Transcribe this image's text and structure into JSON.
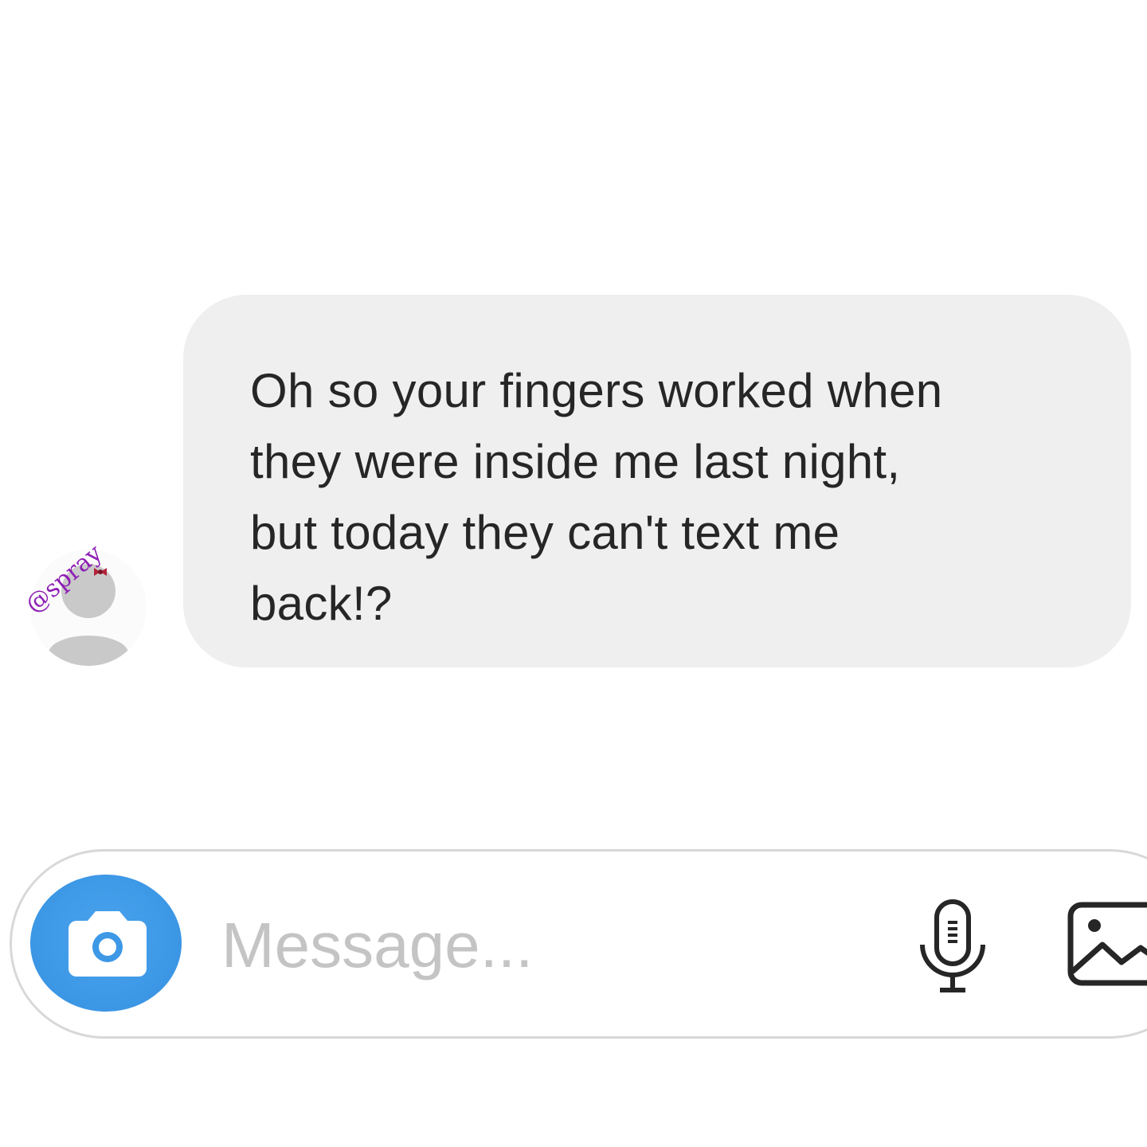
{
  "conversation": {
    "received_message": {
      "lines": [
        "Oh so your fingers worked when",
        "they were inside me last night,",
        "but today they can't text me",
        "back!?"
      ]
    },
    "avatar": {
      "watermark": "@spray",
      "icon": "default-profile-icon"
    }
  },
  "composer": {
    "placeholder": "Message...",
    "camera_icon": "camera-icon",
    "mic_icon": "microphone-icon",
    "gallery_icon": "image-gallery-icon",
    "accent_color": "#3d98e6"
  }
}
